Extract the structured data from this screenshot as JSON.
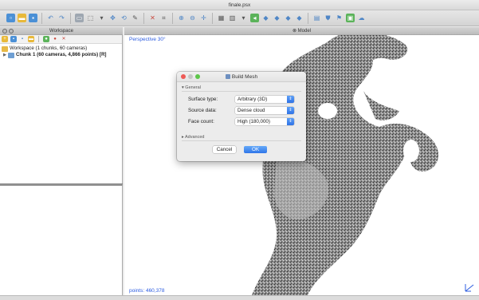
{
  "window": {
    "title": "finale.psx"
  },
  "toolbar": {
    "icons": [
      "new-doc-icon",
      "open-folder-icon",
      "save-icon",
      "undo-icon",
      "redo-icon",
      "select-icon",
      "dropdown-icon",
      "tool-icon",
      "move-icon",
      "rotate-icon",
      "brush-icon",
      "delete-icon",
      "crop-icon",
      "zoom-in-icon",
      "zoom-out-icon",
      "navigate-icon",
      "grid-icon",
      "panel-icon",
      "cameras-icon",
      "chart-icon"
    ]
  },
  "workspace": {
    "header": "Workspace",
    "root_label": "Workspace (1 chunks, 60 cameras)",
    "chunk_label": "Chunk 1 (60 cameras, 4,866 points) [R]"
  },
  "model": {
    "header": "Model",
    "perspective": "Perspective 30°",
    "points": "points: 460,378"
  },
  "dialog": {
    "title": "Build Mesh",
    "general_section": "General",
    "advanced_section": "Advanced",
    "surface_type_label": "Surface type:",
    "surface_type_value": "Arbitrary (3D)",
    "source_data_label": "Source data:",
    "source_data_value": "Dense cloud",
    "face_count_label": "Face count:",
    "face_count_value": "High (180,000)",
    "cancel_label": "Cancel",
    "ok_label": "OK"
  },
  "colors": {
    "accent": "#2f75e8",
    "overlay_text": "#2c5ce0"
  }
}
